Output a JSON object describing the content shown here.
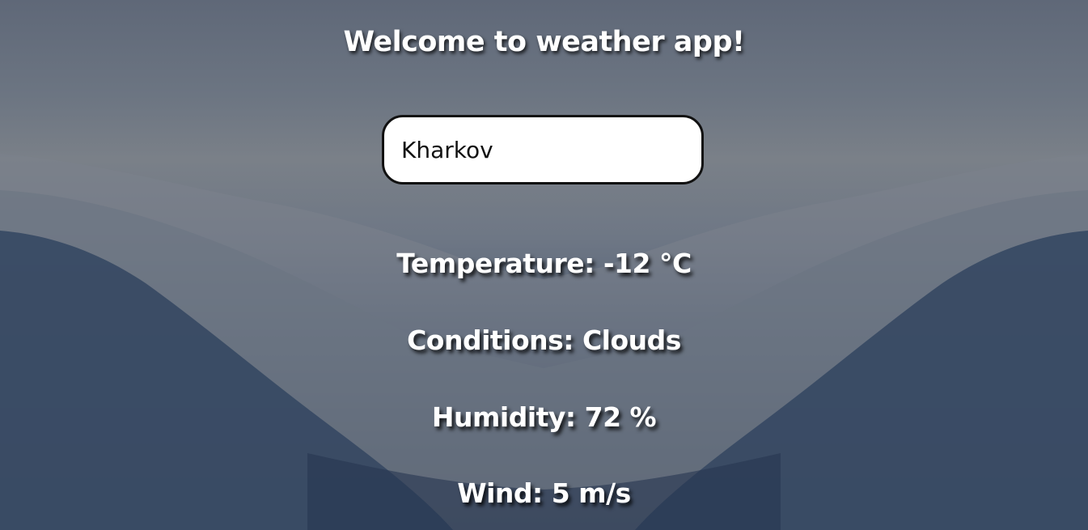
{
  "header": {
    "title": "Welcome to weather app!"
  },
  "search": {
    "value": "Kharkov"
  },
  "weather": {
    "temperature": "Temperature: -12 °C",
    "conditions": "Conditions: Clouds",
    "humidity": "Humidity: 72 %",
    "wind": "Wind: 5 m/s"
  },
  "colors": {
    "text": "#ffffff",
    "input_bg": "#ffffff",
    "input_border": "#111111"
  }
}
